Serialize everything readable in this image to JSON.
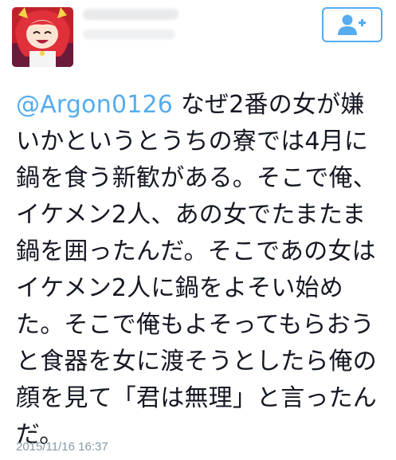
{
  "author": {
    "display_name": "",
    "handle": ""
  },
  "follow_button": {
    "icon": "follow-person-plus-icon",
    "accent_color": "#55acee"
  },
  "tweet": {
    "mention": "@Argon0126",
    "body": " なぜ2番の女が嫌いかというとうちの寮では4月に鍋を食う新歓がある。そこで俺、イケメン2人、あの女でたまたま鍋を囲ったんだ。そこであの女はイケメン2人に鍋をよそい始めた。そこで俺もよそってもらおうと食器を女に渡そうとしたら俺の顔を見て「君は無理」と言ったんだ。",
    "timestamp": "2015/11/16 16:37"
  }
}
